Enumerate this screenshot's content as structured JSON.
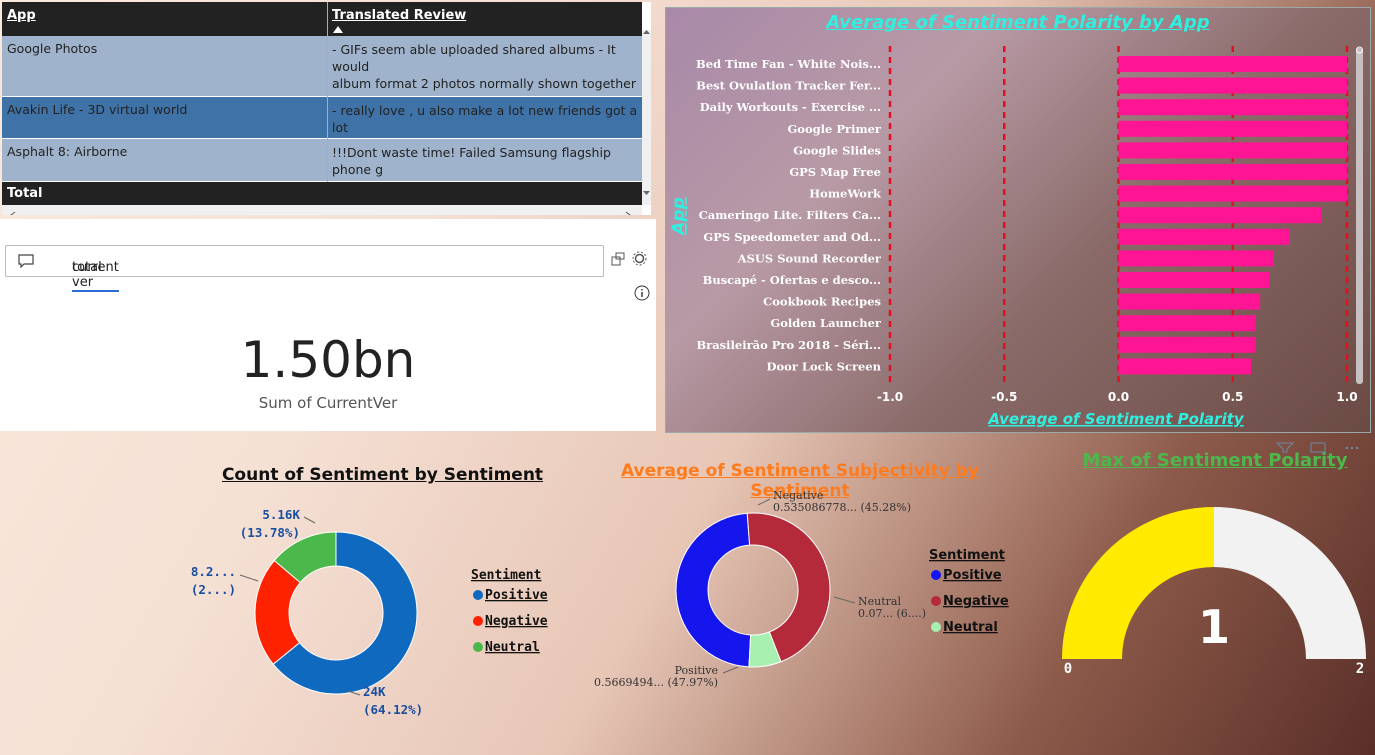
{
  "table": {
    "col_app": "App",
    "col_review": "Translated Review",
    "rows": [
      {
        "app": "Google Photos",
        "review": "- GIFs seem able uploaded shared albums - It would\nalbum format 2 photos normally shown together use\nlocations removed sharing full image message e.g. F",
        "bg": "#9fb4cc"
      },
      {
        "app": "Avakin Life - 3D virtual world",
        "review": "- really love , u also make a lot new friends got a lot\nget game",
        "bg": "#3f72a6"
      },
      {
        "app": "Asphalt 8: Airborne",
        "review": "!!!Dont waste time! Failed Samsung flagship phone g\ndownload, keeps rotates forever proper progress inc",
        "bg": "#9fb4cc"
      }
    ],
    "total_label": "Total"
  },
  "qa": {
    "query_prefix": "total",
    "query_underlined": "current ver",
    "value": "1.50bn",
    "caption": "Sum of CurrentVer"
  },
  "bar_panel": {
    "title": "Average of Sentiment Polarity by App"
  },
  "chart_data": [
    {
      "type": "bar",
      "orientation": "horizontal",
      "title": "Average of Sentiment Polarity by App",
      "xlabel": "Average of Sentiment Polarity",
      "ylabel": "App",
      "xlim": [
        -1.0,
        1.0
      ],
      "xticks": [
        "-1.0",
        "-0.5",
        "0.0",
        "0.5",
        "1.0"
      ],
      "categories": [
        "Bed Time Fan - White Nois...",
        "Best Ovulation Tracker Fer...",
        "Daily Workouts - Exercise ...",
        "Google Primer",
        "Google Slides",
        "GPS Map Free",
        "HomeWork",
        "Cameringo Lite. Filters Ca...",
        "GPS Speedometer and Od...",
        "ASUS Sound Recorder",
        "Buscapé - Ofertas e desco...",
        "Cookbook Recipes",
        "Golden Launcher",
        "Brasileirão Pro 2018 - Séri...",
        "Door Lock Screen"
      ],
      "values": [
        1.0,
        1.0,
        1.0,
        1.0,
        1.0,
        1.0,
        1.0,
        0.89,
        0.75,
        0.68,
        0.66,
        0.62,
        0.6,
        0.6,
        0.58
      ],
      "color": "#ff1493"
    },
    {
      "type": "pie",
      "donut": true,
      "title": "Count of Sentiment by Sentiment",
      "legend_title": "Sentiment",
      "labels": [
        "Positive",
        "Negative",
        "Neutral"
      ],
      "values": [
        64.12,
        22.1,
        13.78
      ],
      "colors": [
        "#0f6abf",
        "#ff2200",
        "#4cb84c"
      ],
      "data_labels": [
        [
          "24K",
          "(64.12%)"
        ],
        [
          "8.2...",
          "(2...)"
        ],
        [
          "5.16K",
          "(13.78%)"
        ]
      ]
    },
    {
      "type": "pie",
      "donut": true,
      "title": "Average of Sentiment Subjectivity by Sentiment",
      "legend_title": "Sentiment",
      "labels": [
        "Positive",
        "Negative",
        "Neutral"
      ],
      "values": [
        47.97,
        45.28,
        6.75
      ],
      "colors": [
        "#1515ee",
        "#b52a3a",
        "#a8f0b0"
      ],
      "data_labels": [
        [
          "Positive",
          "0.5669494... (47.97%)"
        ],
        [
          "Negative",
          "0.535086778... (45.28%)"
        ],
        [
          "Neutral",
          "0.07... (6....)"
        ]
      ]
    },
    {
      "type": "gauge",
      "title": "Max of Sentiment Polarity",
      "value": 1,
      "value_label": "1",
      "min": 0,
      "max": 2,
      "min_label": "0",
      "max_label": "2",
      "fill_color": "#ffea00",
      "track_color": "#f2f2f2"
    }
  ]
}
